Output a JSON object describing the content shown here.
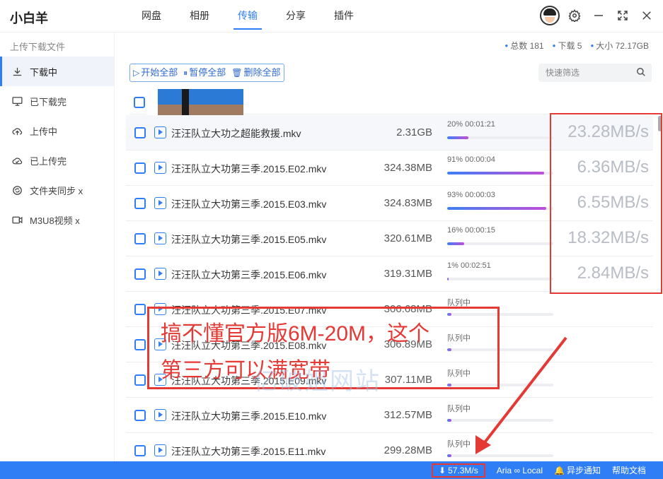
{
  "app": {
    "title": "小白羊"
  },
  "nav": [
    {
      "label": "网盘",
      "active": false
    },
    {
      "label": "相册",
      "active": false
    },
    {
      "label": "传输",
      "active": true
    },
    {
      "label": "分享",
      "active": false
    },
    {
      "label": "插件",
      "active": false
    }
  ],
  "sidebar": {
    "heading": "上传下载文件",
    "items": [
      {
        "label": "下载中",
        "icon": "download-icon",
        "active": true
      },
      {
        "label": "已下载完",
        "icon": "monitor-icon",
        "active": false
      },
      {
        "label": "上传中",
        "icon": "cloud-upload-icon",
        "active": false
      },
      {
        "label": "已上传完",
        "icon": "cloud-check-icon",
        "active": false
      },
      {
        "label": "文件夹同步 x",
        "icon": "sync-icon",
        "active": false
      },
      {
        "label": "M3U8视频 x",
        "icon": "video-icon",
        "active": false
      }
    ]
  },
  "stats": {
    "total": "总数 181",
    "downloading": "下载 5",
    "size": "大小 72.17GB"
  },
  "toolbar": {
    "start_all": "开始全部",
    "pause_all": "暂停全部",
    "delete_all": "删除全部"
  },
  "filter": {
    "placeholder": "快速筛选"
  },
  "files": [
    {
      "name": "汪汪队立大功之超能救援.mkv",
      "size": "2.31GB",
      "progress_text": "20% 00:01:21",
      "progress": 20,
      "speed": "23.28MB/s"
    },
    {
      "name": "汪汪队立大功第三季.2015.E02.mkv",
      "size": "324.38MB",
      "progress_text": "91% 00:00:04",
      "progress": 91,
      "speed": "6.36MB/s"
    },
    {
      "name": "汪汪队立大功第三季.2015.E03.mkv",
      "size": "324.83MB",
      "progress_text": "93% 00:00:03",
      "progress": 93,
      "speed": "6.55MB/s"
    },
    {
      "name": "汪汪队立大功第三季.2015.E05.mkv",
      "size": "320.61MB",
      "progress_text": "16% 00:00:15",
      "progress": 16,
      "speed": "18.32MB/s"
    },
    {
      "name": "汪汪队立大功第三季.2015.E06.mkv",
      "size": "319.31MB",
      "progress_text": "1% 00:02:51",
      "progress": 1,
      "speed": "2.84MB/s"
    },
    {
      "name": "汪汪队立大功第三季.2015.E07.mkv",
      "size": "306.68MB",
      "progress_text": "队列中",
      "progress": 4,
      "speed": ""
    },
    {
      "name": "汪汪队立大功第三季.2015.E08.mkv",
      "size": "306.89MB",
      "progress_text": "队列中",
      "progress": 4,
      "speed": ""
    },
    {
      "name": "汪汪队立大功第三季.2015.E09.mkv",
      "size": "307.11MB",
      "progress_text": "队列中",
      "progress": 4,
      "speed": ""
    },
    {
      "name": "汪汪队立大功第三季.2015.E10.mkv",
      "size": "312.57MB",
      "progress_text": "队列中",
      "progress": 4,
      "speed": ""
    },
    {
      "name": "汪汪队立大功第三季.2015.E11.mkv",
      "size": "299.28MB",
      "progress_text": "队列中",
      "progress": 4,
      "speed": ""
    }
  ],
  "annotation": {
    "line1": "搞不懂官方版6M-20M，这个",
    "line2": "第三方可以满宽带",
    "watermark": "亿破姐网站",
    "color": "#e53935"
  },
  "statusbar": {
    "speed": "57.3M/s",
    "aria": "Aria ∞ Local",
    "notify": "异步通知",
    "help": "帮助文档"
  },
  "colors": {
    "accent": "#2f7ef5",
    "annotation": "#e53935"
  }
}
